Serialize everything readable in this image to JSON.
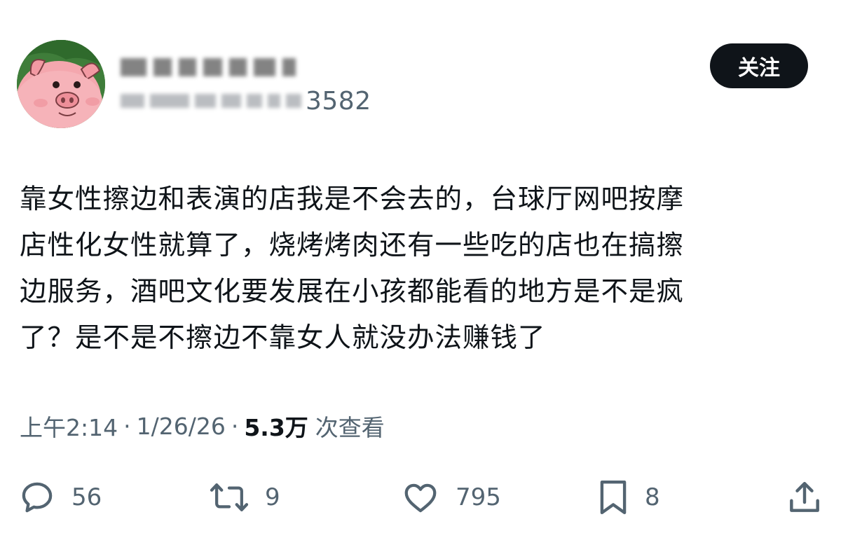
{
  "author": {
    "handle_visible_suffix": "3582"
  },
  "follow_label": "关注",
  "tweet": {
    "lines": [
      "靠女性擦边和表演的店我是不会去的，台球厅网吧按摩",
      "店性化女性就算了，烧烤烤肉还有一些吃的店也在搞擦",
      "边服务，酒吧文化要发展在小孩都能看的地方是不是疯",
      "了？是不是不擦边不靠女人就没办法赚钱了"
    ]
  },
  "meta": {
    "time": "上午2:14",
    "separator": "·",
    "date": "1/26/26",
    "views_count": "5.3万",
    "views_label": "次查看"
  },
  "actions": {
    "replies": "56",
    "reposts": "9",
    "likes": "795",
    "bookmarks": "8"
  },
  "colors": {
    "text_primary": "#0f1419",
    "text_secondary": "#536471",
    "follow_bg": "#0f1419",
    "avatar_bg": "#3f7d3a",
    "avatar_pig": "#f4a7ae"
  },
  "icons": [
    "reply-icon",
    "repost-icon",
    "like-icon",
    "bookmark-icon",
    "share-icon"
  ]
}
